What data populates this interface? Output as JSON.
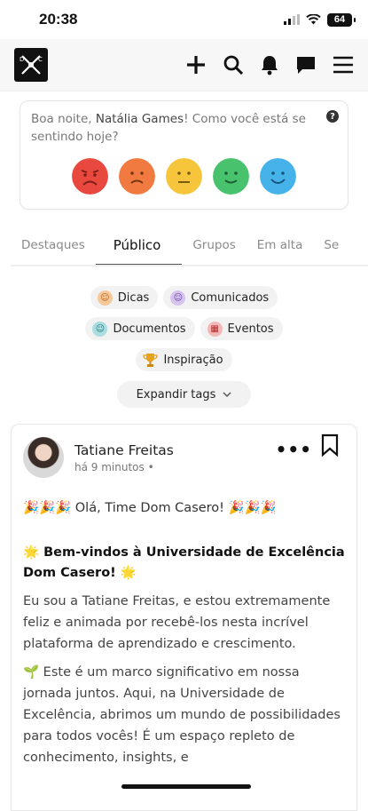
{
  "status": {
    "time": "20:38",
    "battery": "64"
  },
  "header": {
    "icons": [
      "logo-icon",
      "plus-icon",
      "search-icon",
      "bell-icon",
      "chat-icon",
      "menu-icon"
    ]
  },
  "mood": {
    "prompt_prefix": "Boa noite, ",
    "user_name": "Natália Games",
    "prompt_suffix": "! Como você está se sentindo hoje?",
    "help": "?",
    "faces": [
      {
        "name": "very-sad",
        "color": "#e8483d"
      },
      {
        "name": "sad",
        "color": "#f07a3f"
      },
      {
        "name": "neutral",
        "color": "#f7c53b"
      },
      {
        "name": "happy",
        "color": "#48c26d"
      },
      {
        "name": "very-happy",
        "color": "#45b3ea"
      }
    ]
  },
  "tabs": [
    "Destaques",
    "Público",
    "Grupos",
    "Em alta",
    "Se"
  ],
  "active_tab": "Público",
  "tags": {
    "row1": [
      "Dicas",
      "Comunicados"
    ],
    "row2": [
      "Documentos",
      "Eventos"
    ],
    "row3": [
      "Inspiração"
    ],
    "expand": "Expandir tags"
  },
  "post": {
    "author": "Tatiane Freitas",
    "time": "há 9 minutos •",
    "greeting": "🎉🎉🎉 Olá, Time Dom Casero! 🎉🎉🎉",
    "welcome": "🌟 Bem-vindos à Universidade de Excelência Dom Casero! 🌟",
    "para1": "Eu sou a Tatiane Freitas, e estou extremamente feliz e animada por recebê-los nesta incrível plataforma de aprendizado e crescimento.",
    "para2": "🌱 Este é um marco significativo em nossa jornada juntos. Aqui, na Universidade de Excelência, abrimos um mundo de possibilidades para todos vocês! É um espaço repleto de conhecimento, insights, e"
  }
}
